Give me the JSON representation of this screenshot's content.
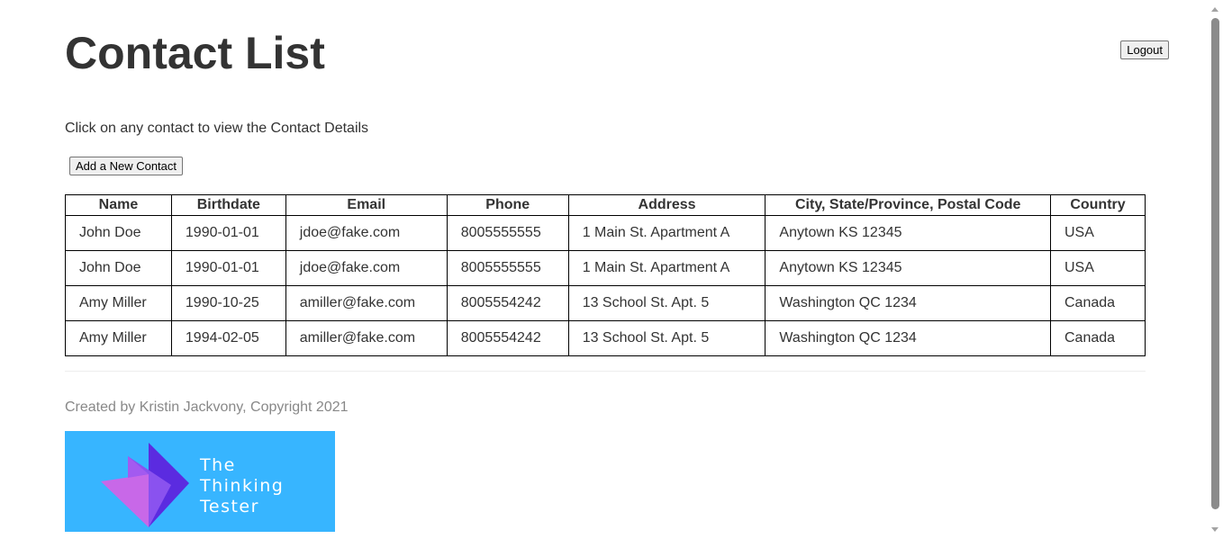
{
  "header": {
    "title": "Contact List",
    "logout_label": "Logout"
  },
  "instructions": "Click on any contact to view the Contact Details",
  "add_contact_label": "Add a New Contact",
  "table": {
    "columns": [
      "Name",
      "Birthdate",
      "Email",
      "Phone",
      "Address",
      "City, State/Province, Postal Code",
      "Country"
    ],
    "rows": [
      [
        "John Doe",
        "1990-01-01",
        "jdoe@fake.com",
        "8005555555",
        "1 Main St. Apartment A",
        "Anytown KS 12345",
        "USA"
      ],
      [
        "John Doe",
        "1990-01-01",
        "jdoe@fake.com",
        "8005555555",
        "1 Main St. Apartment A",
        "Anytown KS 12345",
        "USA"
      ],
      [
        "Amy Miller",
        "1990-10-25",
        "amiller@fake.com",
        "8005554242",
        "13 School St. Apt. 5",
        "Washington QC 1234",
        "Canada"
      ],
      [
        "Amy Miller",
        "1994-02-05",
        "amiller@fake.com",
        "8005554242",
        "13 School St. Apt. 5",
        "Washington QC 1234",
        "Canada"
      ]
    ]
  },
  "footer": {
    "text": "Created by Kristin Jackvony, Copyright 2021",
    "logo_line1": "The",
    "logo_line2": "Thinking",
    "logo_line3": "Tester"
  },
  "colors": {
    "logo_background": "#37b5ff",
    "text": "#333333",
    "footer_text": "#888888"
  }
}
